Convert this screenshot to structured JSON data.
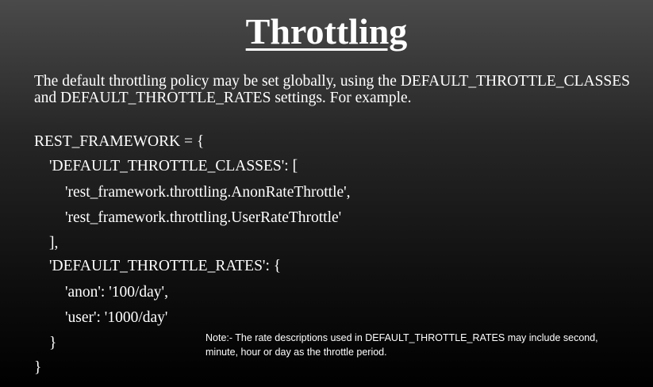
{
  "slide": {
    "title": "Throttling",
    "intro": "The default throttling policy may be set globally, using the DEFAULT_THROTTLE_CLASSES and DEFAULT_THROTTLE_RATES settings. For example.",
    "code": [
      "REST_FRAMEWORK = {",
      "'DEFAULT_THROTTLE_CLASSES': [",
      "'rest_framework.throttling.AnonRateThrottle',",
      "'rest_framework.throttling.UserRateThrottle'",
      "],",
      "'DEFAULT_THROTTLE_RATES': {",
      "'anon': '100/day',",
      "'user': '1000/day'",
      "}",
      "}"
    ],
    "note_line1": "Note:- The rate descriptions used in DEFAULT_THROTTLE_RATES may include second,",
    "note_line2": "minute, hour or day as the throttle period."
  }
}
